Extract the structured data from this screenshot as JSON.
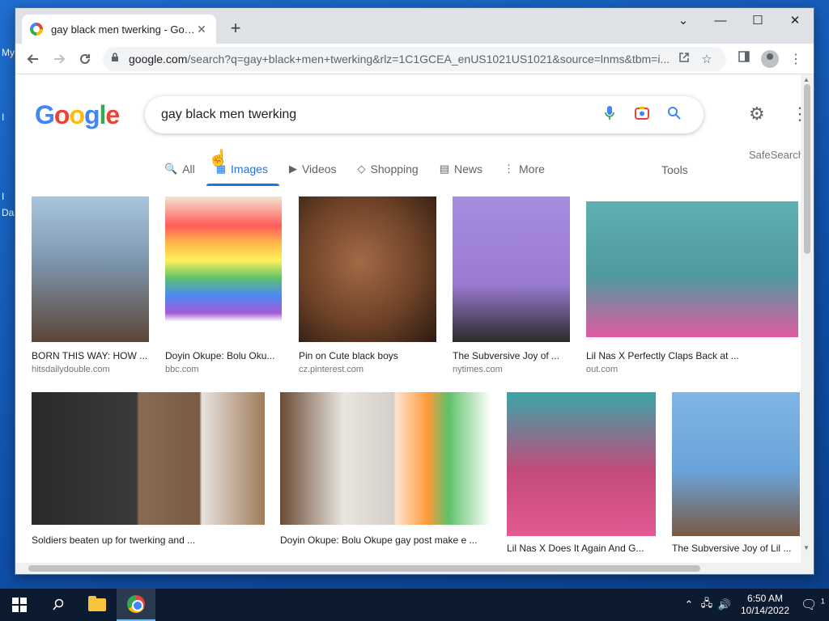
{
  "desktop": {
    "left_labels": [
      "My",
      "I",
      "I",
      "Da"
    ]
  },
  "browser": {
    "tab_title": "gay black men twerking - Google Search",
    "tab_close": "✕",
    "new_tab": "+",
    "window_controls": {
      "tabsearch": "⌄",
      "minimize": "—",
      "maximize": "☐",
      "close": "✕"
    },
    "url_host": "google.com",
    "url_rest": "/search?q=gay+black+men+twerking&rlz=1C1GCEA_enUS1021US1021&source=lnms&tbm=i..."
  },
  "google": {
    "logo": [
      "G",
      "o",
      "o",
      "g",
      "l",
      "e"
    ],
    "query": "gay black men twerking",
    "tabs": [
      {
        "label": "All",
        "icon": "🔍"
      },
      {
        "label": "Images",
        "icon": "▦"
      },
      {
        "label": "Videos",
        "icon": "▶"
      },
      {
        "label": "Shopping",
        "icon": "◇"
      },
      {
        "label": "News",
        "icon": "▤"
      },
      {
        "label": "More",
        "icon": "⋮"
      }
    ],
    "tools": "Tools",
    "safesearch": "SafeSearch"
  },
  "results": [
    {
      "title": "BORN THIS WAY: HOW ...",
      "source": "hitsdailydouble.com",
      "color": "#6f8fa8"
    },
    {
      "title": "Doyin Okupe: Bolu Oku...",
      "source": "bbc.com",
      "color": "#d98c5f"
    },
    {
      "title": "Pin on Cute black boys",
      "source": "cz.pinterest.com",
      "color": "#8a5a3c"
    },
    {
      "title": "The Subversive Joy of ...",
      "source": "nytimes.com",
      "color": "#9a7bd1"
    },
    {
      "title": "Lil Nas X Perfectly Claps Back at ...",
      "source": "out.com",
      "color": "#4f9aa0"
    },
    {
      "title": "Soldiers beaten up for twerking and ...",
      "source": "",
      "color": "#3a3a3a"
    },
    {
      "title": "Doyin Okupe: Bolu Okupe gay post make e ...",
      "source": "",
      "color": "#c2a07a"
    },
    {
      "title": "Lil Nas X Does It Again And G...",
      "source": "",
      "color": "#3aa6a8"
    },
    {
      "title": "The Subversive Joy of Lil ...",
      "source": "",
      "color": "#6aa3d9"
    }
  ],
  "taskbar": {
    "time": "6:50 AM",
    "date": "10/14/2022",
    "notification_count": "1"
  }
}
